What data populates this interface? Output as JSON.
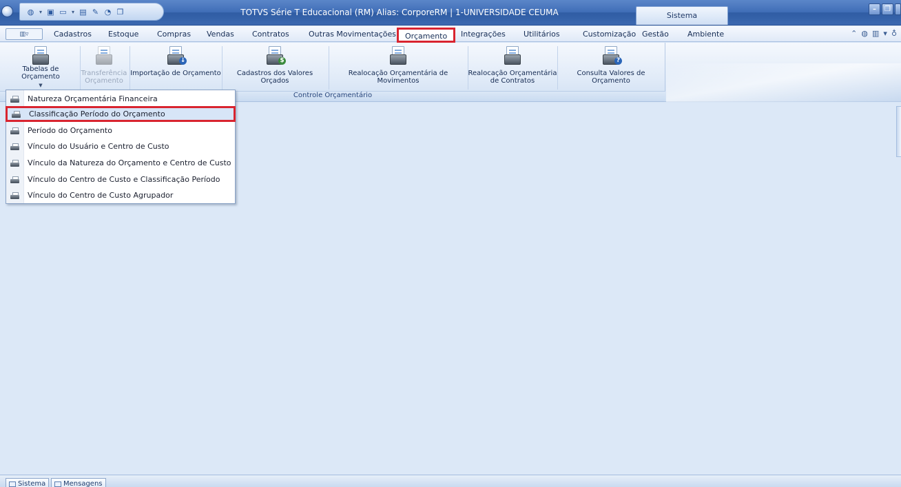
{
  "window": {
    "title": "TOTVS Série T Educacional (RM) Alias: CorporeRM | 1-UNIVERSIDADE CEUMA",
    "title_tab": "Sistema"
  },
  "menu": {
    "app_button_glyph": "▥▿",
    "tabs": [
      "Cadastros",
      "Estoque",
      "Compras",
      "Vendas",
      "Contratos",
      "Outras Movimentações",
      "Orçamento",
      "Integrações",
      "Utilitários",
      "Customização",
      "Gestão",
      "Ambiente"
    ],
    "active_tab": "Orçamento"
  },
  "ribbon": {
    "group_label": "Controle Orçamentário",
    "buttons": [
      {
        "label_line1": "Tabelas de Orçamento",
        "label_line2": "",
        "dropdown": true,
        "enabled": true,
        "icon": "budget-tables-icon"
      },
      {
        "label_line1": "Transferência",
        "label_line2": "Orçamento",
        "dropdown": true,
        "enabled": false,
        "icon": "budget-transfer-icon"
      },
      {
        "label_line1": "Importação de Orçamento",
        "label_line2": "",
        "dropdown": false,
        "enabled": true,
        "icon": "budget-import-icon"
      },
      {
        "label_line1": "Cadastros dos Valores Orçados",
        "label_line2": "",
        "dropdown": false,
        "enabled": true,
        "icon": "budgeted-values-icon"
      },
      {
        "label_line1": "Realocação Orçamentária de Movimentos",
        "label_line2": "",
        "dropdown": false,
        "enabled": true,
        "icon": "movement-reallocation-icon"
      },
      {
        "label_line1": "Realocação Orçamentária",
        "label_line2": "de Contratos",
        "dropdown": false,
        "enabled": true,
        "icon": "contract-reallocation-icon"
      },
      {
        "label_line1": "Consulta Valores de Orçamento",
        "label_line2": "",
        "dropdown": false,
        "enabled": true,
        "icon": "budget-query-icon"
      }
    ]
  },
  "dropdown": {
    "items": [
      "Natureza Orçamentária Financeira",
      "Classificação Período do Orçamento",
      "Período do Orçamento",
      "Vínculo do Usuário e Centro de Custo",
      "Vínculo da Natureza do Orçamento e Centro de Custo",
      "Vínculo do Centro de Custo e Classificação Período",
      "Vínculo do Centro de Custo Agrupador"
    ],
    "selected_index": 1
  },
  "statusbar": {
    "buttons": [
      "Sistema",
      "Mensagens"
    ]
  },
  "colors": {
    "highlight_border": "#d9242f",
    "title_bar": "#3f6db6",
    "workspace": "#dce8f7"
  }
}
